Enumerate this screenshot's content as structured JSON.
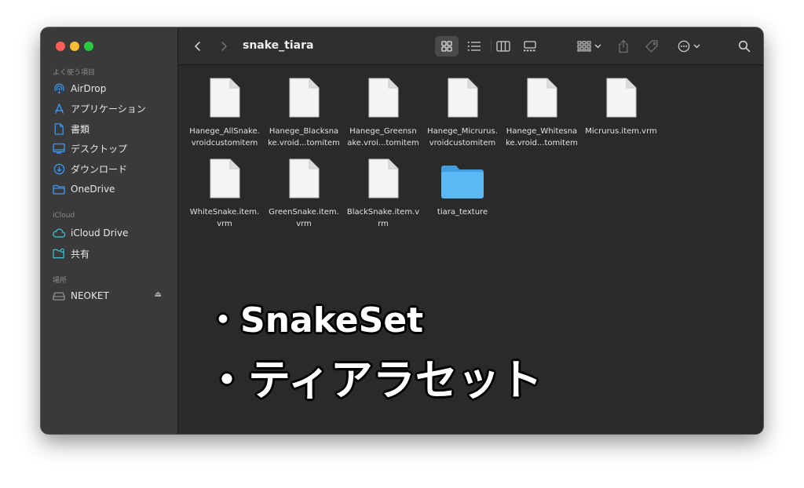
{
  "window": {
    "title": "snake_tiara"
  },
  "sidebar": {
    "favorites_label": "よく使う項目",
    "favorites": [
      {
        "label": "AirDrop",
        "icon": "airdrop-icon"
      },
      {
        "label": "アプリケーション",
        "icon": "applications-icon"
      },
      {
        "label": "書類",
        "icon": "document-icon"
      },
      {
        "label": "デスクトップ",
        "icon": "desktop-icon"
      },
      {
        "label": "ダウンロード",
        "icon": "download-icon"
      },
      {
        "label": "OneDrive",
        "icon": "folder-icon"
      }
    ],
    "icloud_label": "iCloud",
    "icloud": [
      {
        "label": "iCloud Drive",
        "icon": "cloud-icon"
      },
      {
        "label": "共有",
        "icon": "shared-folder-icon"
      }
    ],
    "locations_label": "場所",
    "locations": [
      {
        "label": "NEOKET",
        "icon": "drive-icon"
      }
    ]
  },
  "files": [
    {
      "name": "Hanege_AllSnake.vroidcustomitem",
      "line1": "Hanege_AllSnake.",
      "line2": "vroidcustomitem",
      "kind": "document"
    },
    {
      "name": "Hanege_Blacksnake.vroid...tomitem",
      "line1": "Hanege_Blacksna",
      "line2": "ke.vroid...tomitem",
      "kind": "document"
    },
    {
      "name": "Hanege_Greensnake.vroi...tomitem",
      "line1": "Hanege_Greensn",
      "line2": "ake.vroi...tomitem",
      "kind": "document"
    },
    {
      "name": "Hanege_Micrurus.vroidcustomitem",
      "line1": "Hanege_Micrurus.",
      "line2": "vroidcustomitem",
      "kind": "document"
    },
    {
      "name": "Hanege_Whitesnake.vroid...tomitem",
      "line1": "Hanege_Whitesna",
      "line2": "ke.vroid...tomitem",
      "kind": "document"
    },
    {
      "name": "Micrurus.item.vrm",
      "line1": "Micrurus.item.vrm",
      "line2": "",
      "kind": "document"
    },
    {
      "name": "WhiteSnake.item.vrm",
      "line1": "WhiteSnake.item.",
      "line2": "vrm",
      "kind": "document"
    },
    {
      "name": "GreenSnake.item.vrm",
      "line1": "GreenSnake.item.",
      "line2": "vrm",
      "kind": "document"
    },
    {
      "name": "BlackSnake.item.vrm",
      "line1": "BlackSnake.item.v",
      "line2": "rm",
      "kind": "document"
    },
    {
      "name": "tiara_texture",
      "line1": "tiara_texture",
      "line2": "",
      "kind": "folder"
    }
  ],
  "overlay": {
    "line1": "・SnakeSet",
    "line2": "・ティアラセット"
  },
  "colors": {
    "accent": "#3b9bff",
    "folder": "#5ab8f5",
    "sidebar_bg": "#3a3a3b",
    "content_bg": "#2a2a28"
  }
}
